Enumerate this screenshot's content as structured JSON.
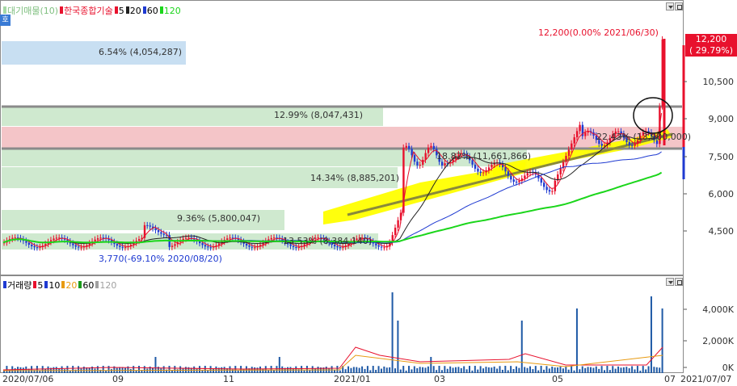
{
  "legend_top": {
    "items": [
      {
        "label": "대기매물(10)",
        "color": "#a6d8a6"
      },
      {
        "label": "한국종합기술",
        "color": "#e8112d"
      },
      {
        "label": "5",
        "color": "#e8112d"
      },
      {
        "label": "20",
        "color": "#222222"
      },
      {
        "label": "60",
        "color": "#1f3ad1"
      },
      {
        "label": "120",
        "color": "#1bd61b"
      }
    ]
  },
  "legend_bottom": {
    "items": [
      {
        "label": "거래량",
        "color": "#1f3ad1"
      },
      {
        "label": "5",
        "color": "#e8112d"
      },
      {
        "label": "10",
        "color": "#1f3ad1"
      },
      {
        "label": "20",
        "color": "#e89a10"
      },
      {
        "label": "60",
        "color": "#1b9a1b"
      },
      {
        "label": "120",
        "color": "#a0a0a0"
      }
    ]
  },
  "side_tab": "호",
  "price_axis": {
    "ticks": [
      "10,500",
      "9,000",
      "7,500",
      "6,000",
      "4,500"
    ]
  },
  "volume_axis": {
    "ticks": [
      "4,000K",
      "2,000K",
      "0K"
    ]
  },
  "date_axis": {
    "ticks": [
      "2020/07/06",
      "09",
      "11",
      "2021/01",
      "03",
      "05",
      "07",
      "2021/07/07"
    ]
  },
  "current_price": {
    "value": "12,200",
    "change": "( 29.79%)"
  },
  "annotations": {
    "high": "12,200(0.00% 2021/06/30)",
    "low": "3,770(-69.10% 2020/08/20)"
  },
  "volume_profile": [
    {
      "label": "6.54% (4,054,287)",
      "kind": "blue"
    },
    {
      "label": "12.99% (8,047,431)",
      "kind": "green"
    },
    {
      "label": "18.82% (11,661,866)",
      "kind": "red"
    },
    {
      "label": "14.34% (8,885,201)",
      "kind": "green"
    },
    {
      "label": "9.36% (5,800,047)",
      "kind": "green"
    },
    {
      "label": "13.53% (8,384,140)",
      "kind": "green"
    },
    {
      "label": "22.43% (13,900,000)",
      "kind": "red"
    }
  ],
  "colors": {
    "up": "#e8112d",
    "down": "#1f3ad1",
    "ma5": "#e8112d",
    "ma20": "#222222",
    "ma60": "#1f3ad1",
    "ma120": "#1bd61b",
    "highlight": "#ffff00",
    "trendline": "#8a8a3a",
    "profile_green": "#cfe9cf",
    "profile_red": "#f4c5c8",
    "profile_blue": "#c8dff2"
  }
}
